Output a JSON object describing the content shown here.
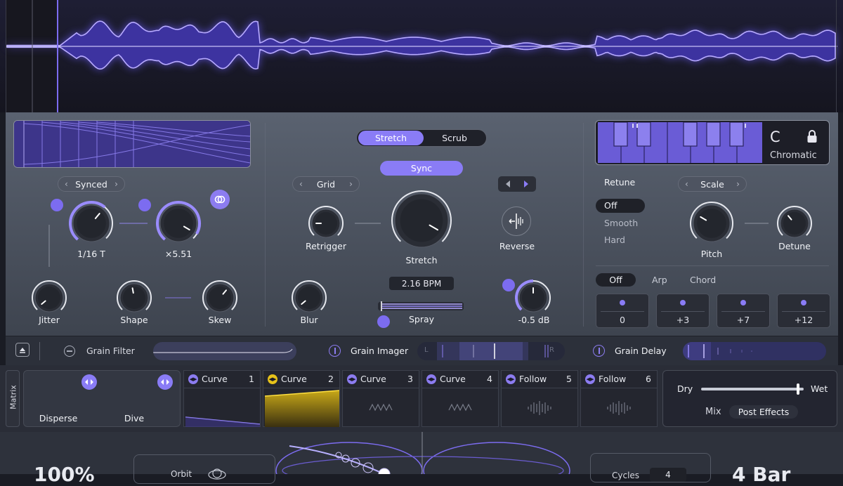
{
  "colors": {
    "accent": "#7c6cf0",
    "accent_light": "#9a8cff",
    "curve2": "#e6c21a"
  },
  "grain": {
    "mode_selector": "Synced",
    "knobs": {
      "rate": "1/16 T",
      "multiplier": "×5.51",
      "jitter": "Jitter",
      "shape": "Shape",
      "skew": "Skew"
    }
  },
  "playback": {
    "tabs": [
      "Stretch",
      "Scrub"
    ],
    "active_tab": "Stretch",
    "sync_label": "Sync",
    "grid_selector": "Grid",
    "retrigger": "Retrigger",
    "stretch": "Stretch",
    "reverse": "Reverse",
    "bpm": "2.16 BPM",
    "blur": "Blur",
    "spray": "Spray",
    "gain": "-0.5 dB"
  },
  "pitch": {
    "key": "C",
    "scale_name": "Chromatic",
    "retune_label": "Retune",
    "retune_options": [
      "Off",
      "Smooth",
      "Hard"
    ],
    "retune_selected": "Off",
    "scale_selector": "Scale",
    "pitch_label": "Pitch",
    "detune_label": "Detune",
    "chord_tabs": [
      "Off",
      "Arp",
      "Chord"
    ],
    "chord_selected": "Off",
    "intervals": [
      "0",
      "+3",
      "+7",
      "+12"
    ]
  },
  "fx_strip": {
    "grain_filter": "Grain Filter",
    "grain_imager": "Grain Imager",
    "grain_delay": "Grain Delay",
    "imager_left": "L",
    "imager_right": "R"
  },
  "matrix": {
    "title": "Matrix",
    "disperse": "Disperse",
    "dive": "Dive",
    "modulators": [
      {
        "name": "Curve",
        "num": "1"
      },
      {
        "name": "Curve",
        "num": "2"
      },
      {
        "name": "Curve",
        "num": "3"
      },
      {
        "name": "Curve",
        "num": "4"
      },
      {
        "name": "Follow",
        "num": "5"
      },
      {
        "name": "Follow",
        "num": "6"
      }
    ]
  },
  "mix": {
    "dry": "Dry",
    "wet": "Wet",
    "mix": "Mix",
    "post_effects": "Post Effects",
    "value": 0.96
  },
  "bottom": {
    "percent": "100%",
    "orbit": "Orbit",
    "cycles": "Cycles",
    "cycles_value": "4",
    "bar": "4 Bar"
  }
}
